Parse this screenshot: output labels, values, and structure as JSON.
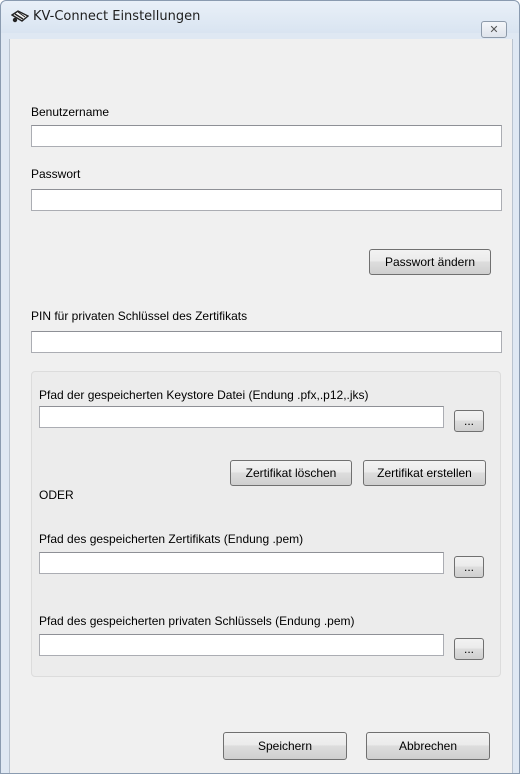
{
  "window": {
    "title": "KV-Connect Einstellungen",
    "close_label": "✕",
    "icon": "app-connector-icon"
  },
  "form": {
    "username_label": "Benutzername",
    "username_value": "",
    "password_label": "Passwort",
    "password_value": "",
    "change_password_label": "Passwort ändern",
    "pin_label": "PIN für privaten Schlüssel des Zertifikats",
    "pin_value": ""
  },
  "certificate": {
    "keystore_label": "Pfad der gespeicherten Keystore Datei (Endung .pfx,.p12,.jks)",
    "keystore_value": "",
    "browse_label": "...",
    "delete_cert_label": "Zertifikat löschen",
    "create_cert_label": "Zertifikat erstellen",
    "or_label": "ODER",
    "cert_path_label": "Pfad des gespeicherten Zertifikats (Endung .pem)",
    "cert_path_value": "",
    "key_path_label": "Pfad des gespeicherten privaten Schlüssels (Endung .pem)",
    "key_path_value": ""
  },
  "footer": {
    "save_label": "Speichern",
    "cancel_label": "Abbrechen"
  }
}
